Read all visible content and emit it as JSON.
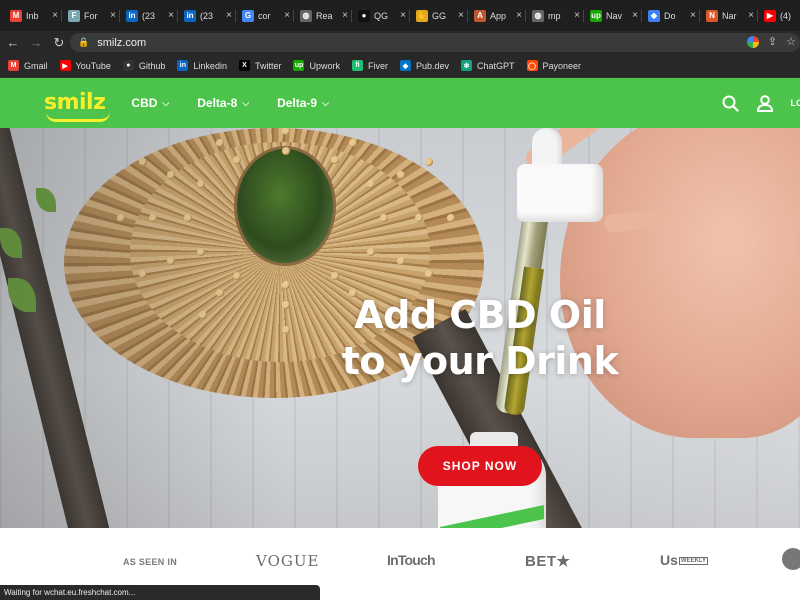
{
  "browser": {
    "tabs": [
      {
        "label": "Inb",
        "icon": "gmail-icon",
        "color": "#ea4335",
        "glyph": "M"
      },
      {
        "label": "For",
        "icon": "form-icon",
        "color": "#7aa6b0",
        "glyph": "F"
      },
      {
        "label": "(23",
        "icon": "linkedin-icon",
        "color": "#0a66c2",
        "glyph": "in"
      },
      {
        "label": "(23",
        "icon": "linkedin-icon",
        "color": "#0a66c2",
        "glyph": "in"
      },
      {
        "label": "cor",
        "icon": "google-icon",
        "color": "#4285f4",
        "glyph": "G"
      },
      {
        "label": "Rea",
        "icon": "globe-icon",
        "color": "#666666",
        "glyph": "◍"
      },
      {
        "label": "QG",
        "icon": "github-icon",
        "color": "#111111",
        "glyph": "●"
      },
      {
        "label": "GG",
        "icon": "hand-icon",
        "color": "#e6a819",
        "glyph": "✋"
      },
      {
        "label": "App",
        "icon": "app-icon",
        "color": "#c0582f",
        "glyph": "A"
      },
      {
        "label": "mp",
        "icon": "globe-icon",
        "color": "#666666",
        "glyph": "◍"
      },
      {
        "label": "Nav",
        "icon": "upwork-icon",
        "color": "#14a800",
        "glyph": "up"
      },
      {
        "label": "Do",
        "icon": "diamond-icon",
        "color": "#3b82f6",
        "glyph": "◆"
      },
      {
        "label": "Nar",
        "icon": "app-icon",
        "color": "#e0562b",
        "glyph": "N"
      },
      {
        "label": "(4)",
        "icon": "youtube-icon",
        "color": "#ff0000",
        "glyph": "▶"
      }
    ],
    "tab_close": "×",
    "url": "smilz.com",
    "bookmarks": [
      {
        "label": "Gmail",
        "icon": "gmail-icon",
        "color": "#ea4335",
        "glyph": "M"
      },
      {
        "label": "YouTube",
        "icon": "youtube-icon",
        "color": "#ff0000",
        "glyph": "▶"
      },
      {
        "label": "Github",
        "icon": "github-icon",
        "color": "#333333",
        "glyph": "●"
      },
      {
        "label": "Linkedin",
        "icon": "linkedin-icon",
        "color": "#0a66c2",
        "glyph": "in"
      },
      {
        "label": "Twitter",
        "icon": "x-icon",
        "color": "#000000",
        "glyph": "X"
      },
      {
        "label": "Upwork",
        "icon": "upwork-icon",
        "color": "#14a800",
        "glyph": "up"
      },
      {
        "label": "Fiver",
        "icon": "fiverr-icon",
        "color": "#1dbf73",
        "glyph": "fi"
      },
      {
        "label": "Pub.dev",
        "icon": "dart-icon",
        "color": "#0175c2",
        "glyph": "◆"
      },
      {
        "label": "ChatGPT",
        "icon": "openai-icon",
        "color": "#10a37f",
        "glyph": "✻"
      },
      {
        "label": "Payoneer",
        "icon": "payoneer-icon",
        "color": "#ff4800",
        "glyph": "◯"
      }
    ],
    "status_text": "Waiting for wchat.eu.freshchat.com..."
  },
  "site": {
    "logo": "smilz",
    "nav": [
      {
        "label": "CBD"
      },
      {
        "label": "Delta-8"
      },
      {
        "label": "Delta-9"
      }
    ],
    "login_partial": "LO",
    "accent": "#4cc34a",
    "logo_color": "#f6f02c",
    "cta_color": "#e1141e"
  },
  "hero": {
    "title_line1": "Add CBD Oil",
    "title_line2": "to your Drink",
    "cta": "SHOP NOW"
  },
  "press": {
    "label": "AS SEEN IN",
    "brands": {
      "vogue": "VOGUE",
      "intouch": "InTouch",
      "bet": "BET★",
      "us": "Us",
      "us_small": "WEEKLY"
    }
  }
}
